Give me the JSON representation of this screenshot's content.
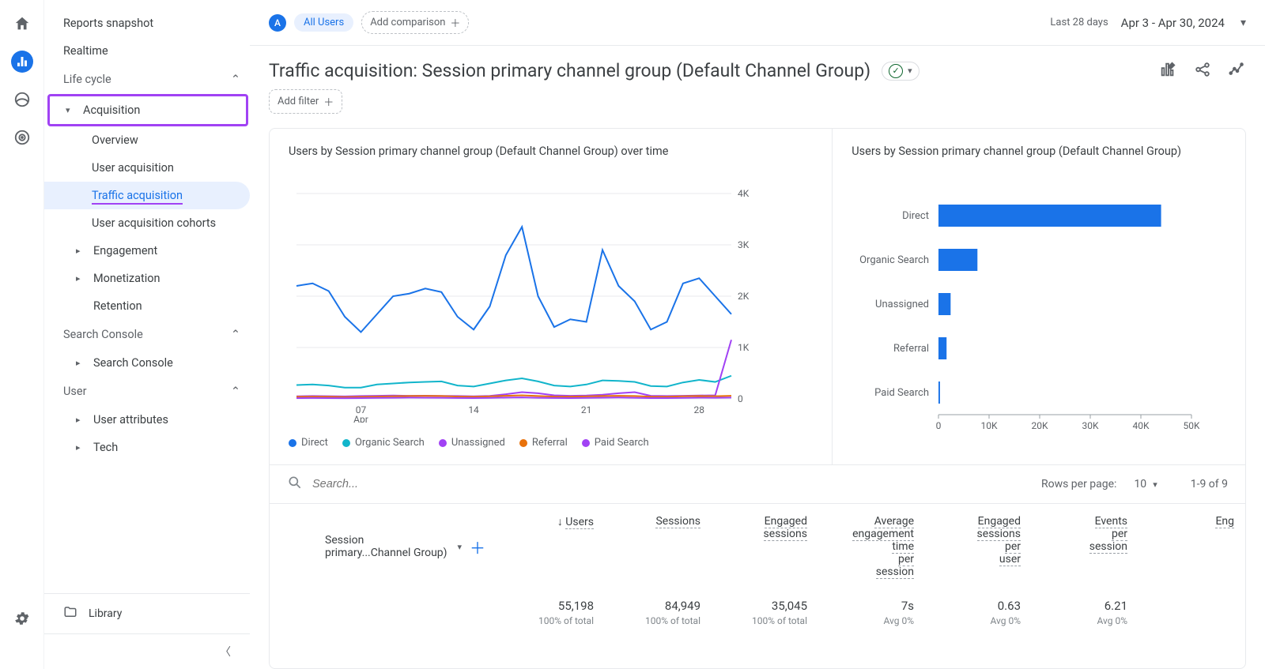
{
  "rail": {
    "home": "home",
    "reports": "reports",
    "explore": "explore",
    "ads": "ads",
    "admin": "admin"
  },
  "sidebar": {
    "items": [
      "Reports snapshot",
      "Realtime"
    ],
    "lifecycle": {
      "label": "Life cycle",
      "acquisition": {
        "label": "Acquisition",
        "children": [
          "Overview",
          "User acquisition",
          "Traffic acquisition",
          "User acquisition cohorts"
        ]
      },
      "engagement": "Engagement",
      "monetization": "Monetization",
      "retention": "Retention"
    },
    "searchconsole": {
      "label": "Search Console",
      "child": "Search Console"
    },
    "user": {
      "label": "User",
      "children": [
        "User attributes",
        "Tech"
      ]
    },
    "library": "Library"
  },
  "topbar": {
    "badge": "A",
    "all_users": "All Users",
    "add_comparison": "Add comparison",
    "last_28": "Last 28 days",
    "date_range": "Apr 3 - Apr 30, 2024"
  },
  "header": {
    "title": "Traffic acquisition: Session primary channel group (Default Channel Group)",
    "add_filter": "Add filter"
  },
  "chart_left": {
    "title": "Users by Session primary channel group (Default Channel Group) over time",
    "legend": [
      "Direct",
      "Organic Search",
      "Unassigned",
      "Referral",
      "Paid Search"
    ],
    "colors": [
      "#1a73e8",
      "#12b5cb",
      "#a142f4",
      "#e8710a",
      "#a142f4"
    ]
  },
  "chart_right": {
    "title": "Users by Session primary channel group (Default Channel Group)"
  },
  "table": {
    "search_ph": "Search...",
    "rows_label": "Rows per page:",
    "rows_val": "10",
    "range": "1-9 of 9",
    "dim_label": "Session primary...Channel Group)",
    "cols": [
      "Users",
      "Sessions",
      "Engaged sessions",
      "Average engagement time per session",
      "Engaged sessions per user",
      "Events per session",
      "Eng"
    ],
    "totals": {
      "values": [
        "55,198",
        "84,949",
        "35,045",
        "7s",
        "0.63",
        "6.21",
        ""
      ],
      "subs": [
        "100% of total",
        "100% of total",
        "100% of total",
        "Avg 0%",
        "Avg 0%",
        "Avg 0%",
        ""
      ]
    }
  },
  "chart_data": [
    {
      "type": "line",
      "title": "Users by Session primary channel group (Default Channel Group) over time",
      "xlabel": "Apr",
      "ylabel": "",
      "ylim": [
        0,
        4000
      ],
      "x_ticks": [
        "07",
        "14",
        "21",
        "28"
      ],
      "y_ticks": [
        0,
        "1K",
        "2K",
        "3K",
        "4K"
      ],
      "x": [
        3,
        4,
        5,
        6,
        7,
        8,
        9,
        10,
        11,
        12,
        13,
        14,
        15,
        16,
        17,
        18,
        19,
        20,
        21,
        22,
        23,
        24,
        25,
        26,
        27,
        28,
        29,
        30
      ],
      "series": [
        {
          "name": "Direct",
          "color": "#1a73e8",
          "values": [
            2200,
            2250,
            2100,
            1600,
            1300,
            1650,
            2000,
            2050,
            2150,
            2080,
            1600,
            1350,
            1800,
            2800,
            3350,
            2000,
            1400,
            1550,
            1500,
            2900,
            2200,
            1900,
            1350,
            1500,
            2250,
            2350,
            2000,
            1650
          ]
        },
        {
          "name": "Organic Search",
          "color": "#12b5cb",
          "values": [
            270,
            280,
            260,
            220,
            220,
            280,
            300,
            320,
            330,
            340,
            260,
            240,
            300,
            360,
            400,
            340,
            260,
            240,
            280,
            360,
            350,
            330,
            250,
            240,
            320,
            370,
            330,
            450
          ]
        },
        {
          "name": "Unassigned",
          "color": "#a142f4",
          "values": [
            50,
            55,
            52,
            48,
            55,
            60,
            65,
            60,
            62,
            58,
            55,
            50,
            58,
            90,
            130,
            110,
            70,
            60,
            65,
            80,
            110,
            130,
            60,
            55,
            60,
            65,
            70,
            1150
          ]
        },
        {
          "name": "Referral",
          "color": "#e8710a",
          "values": [
            40,
            42,
            40,
            35,
            38,
            45,
            50,
            55,
            58,
            55,
            45,
            40,
            48,
            60,
            70,
            55,
            45,
            42,
            48,
            55,
            60,
            55,
            42,
            40,
            50,
            55,
            52,
            60
          ]
        },
        {
          "name": "Paid Search",
          "color": "#a142f4",
          "values": [
            15,
            18,
            16,
            14,
            16,
            20,
            22,
            25,
            24,
            22,
            18,
            15,
            20,
            25,
            28,
            22,
            18,
            16,
            20,
            24,
            26,
            22,
            16,
            15,
            20,
            24,
            22,
            25
          ]
        }
      ]
    },
    {
      "type": "bar",
      "title": "Users by Session primary channel group (Default Channel Group)",
      "orientation": "horizontal",
      "categories": [
        "Direct",
        "Organic Search",
        "Unassigned",
        "Referral",
        "Paid Search"
      ],
      "values": [
        44000,
        7700,
        2400,
        1600,
        300
      ],
      "xlabel": "",
      "ylabel": "",
      "xlim": [
        0,
        50000
      ],
      "x_ticks": [
        "0",
        "10K",
        "20K",
        "30K",
        "40K",
        "50K"
      ]
    }
  ]
}
